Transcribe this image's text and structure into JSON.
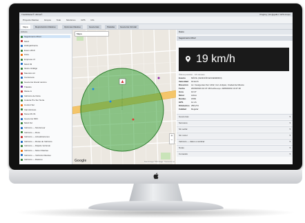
{
  "window": {
    "title": "TrackMaster® Ultima®",
    "user": "Pingboy | kk.@gallet. GPS-Grupo"
  },
  "toolbar": [
    "Proyecto Rastreo",
    "Grupos",
    "Todo",
    "Monitoreo",
    "GPS",
    "Info"
  ],
  "tabs": [
    "Mapa",
    "Reproducción Rastreo",
    "Opciones Rastreo",
    "Geocercas",
    "Paradas",
    "Geocerca Circular"
  ],
  "map_tabs": [
    "Grupos: Ejecutivo flota",
    "Rastreo",
    "Histórico"
  ],
  "map": {
    "type_button": "Mapa",
    "provider": "Google",
    "attribution": "Datos del mapa ©2019 Google · Términos de uso"
  },
  "sidebar": {
    "header": "Activos",
    "items": [
      {
        "label": "Seguimiento Móvil",
        "color": "#2e7d32"
      },
      {
        "label": "Móvil",
        "color": "#c62828"
      },
      {
        "label": "Hidrojardinería",
        "color": "#1565c0"
      },
      {
        "label": "Enero 2019",
        "color": "#2e7d32"
      },
      {
        "label": "Flota",
        "color": "#ef6c00"
      },
      {
        "label": "Empresa JJ",
        "color": "#2e7d32"
      },
      {
        "label": "Móvil 03",
        "color": "#1565c0"
      },
      {
        "label": "Ilustre Hidalgo",
        "color": "#2e7d32"
      },
      {
        "label": "Mauricio A4",
        "color": "#c62828"
      },
      {
        "label": "Camioneta",
        "color": "#1565c0"
      },
      {
        "label": "Geocerca Grand camino",
        "color": "#2e7d32"
      },
      {
        "label": "Tránsito",
        "color": "#6a1b9a"
      },
      {
        "label": "Ilíaca-cx",
        "color": "#c62828"
      },
      {
        "label": "Vehículo de Norte",
        "color": "#1565c0"
      },
      {
        "label": "Colecta Pro Sur Norte",
        "color": "#2e7d32"
      },
      {
        "label": "Control Sur",
        "color": "#ef6c00"
      },
      {
        "label": "Vial Vehículo",
        "color": "#2e7d32"
      },
      {
        "label": "Nieve Mx 01",
        "color": "#c62828"
      },
      {
        "label": "Geocerca NDC",
        "color": "#1565c0"
      },
      {
        "label": "Móvil Ful",
        "color": "#2e7d32"
      },
      {
        "label": "Vehículo — Monitorear",
        "color": "#1565c0"
      },
      {
        "label": "Vehículo — Ruta",
        "color": "#2e7d32"
      },
      {
        "label": "Vehículo — Actualizaciones",
        "color": "#c62828"
      },
      {
        "label": "Vehículo — Rutas de Vehículo",
        "color": "#1565c0"
      },
      {
        "label": "Vehículo — Rápido Vehículo",
        "color": "#2e7d32"
      },
      {
        "label": "Vehículo — Motor Rastreo",
        "color": "#ef6c00"
      },
      {
        "label": "Vehículo — Vehículo Rastreo",
        "color": "#1565c0"
      },
      {
        "label": "Vehículo — Rastreo",
        "color": "#2e7d32"
      }
    ]
  },
  "panel": {
    "header": "Datos",
    "subheader": "Seguimiento Móvil",
    "speed": "19 km/h",
    "status_line": "Última posición · 16 minutos",
    "fields": [
      {
        "key": "Evento",
        "value": "MÓVIL (IGNICIÓN ENCENDIDO)"
      },
      {
        "key": "Velocidad",
        "value": "19 km/h"
      },
      {
        "key": "Dirección",
        "value": "Av. Insurgentes Sur 1432, Col. Actipan, Ciudad de México"
      },
      {
        "key": "Fecha",
        "value": "20/09/2019 10:47:18   Fecha equ.  20/09/2019 10:47:18"
      },
      {
        "key": "Hora",
        "value": "10:47"
      },
      {
        "key": "Motor",
        "value": "Activo"
      },
      {
        "key": "Rumbo",
        "value": "159N"
      },
      {
        "key": "GPS",
        "value": "11 LS"
      },
      {
        "key": "Kilómetros",
        "value": "258,274"
      },
      {
        "key": "Calidad",
        "value": "Regular"
      }
    ],
    "sections": [
      "Geocercas",
      "Sensores",
      "Sin señal",
      "Sin motor",
      "Vehículo — datos a cambiar",
      "Notas",
      "Comando"
    ]
  }
}
